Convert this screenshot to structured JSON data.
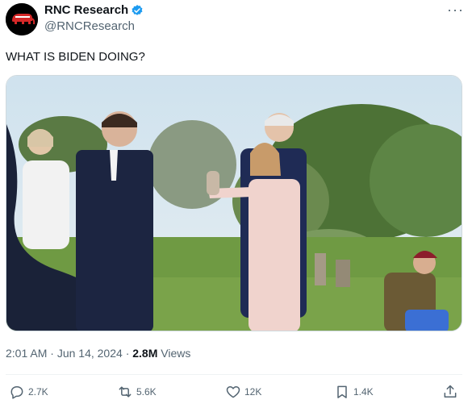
{
  "author": {
    "display_name": "RNC Research",
    "handle": "@RNCResearch",
    "avatar_icon": "republican-elephant-icon",
    "verified_icon": "verified-badge-icon",
    "accent": "#1d9bf0",
    "avatar_red": "#d62828"
  },
  "more_icon": "more-options-icon",
  "tweet": {
    "text": "WHAT IS BIDEN DOING?"
  },
  "meta": {
    "time": "2:01 AM",
    "sep1": "·",
    "date": "Jun 14, 2024",
    "sep2": "·",
    "views_count": "2.8M",
    "views_label": "Views"
  },
  "actions": {
    "reply": {
      "icon": "reply-icon",
      "count": "2.7K"
    },
    "retweet": {
      "icon": "retweet-icon",
      "count": "5.6K"
    },
    "like": {
      "icon": "heart-icon",
      "count": "12K"
    },
    "bookmark": {
      "icon": "bookmark-icon",
      "count": "1.4K"
    },
    "share": {
      "icon": "share-icon"
    }
  }
}
